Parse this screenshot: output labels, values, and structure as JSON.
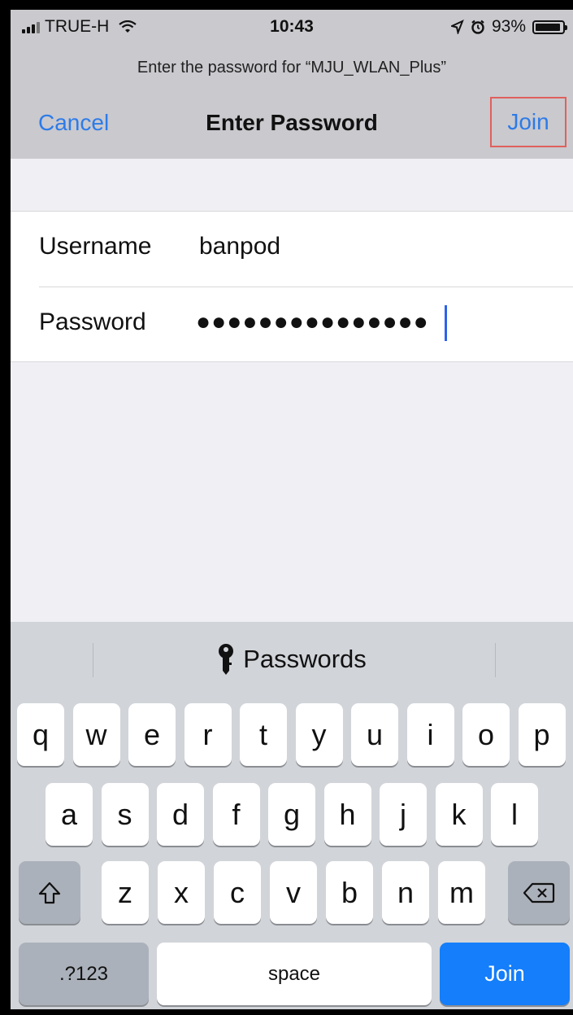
{
  "status_bar": {
    "carrier": "TRUE-H",
    "time": "10:43",
    "battery": "93%",
    "battery_level": 0.93
  },
  "prompt": "Enter the password for “MJU_WLAN_Plus”",
  "nav": {
    "cancel": "Cancel",
    "title": "Enter Password",
    "join": "Join"
  },
  "form": {
    "username_label": "Username",
    "username_value": "banpod",
    "password_label": "Password",
    "password_mask": "●●●●●●●●●●●●●●●"
  },
  "keyboard": {
    "suggestion": "Passwords",
    "row1": [
      "q",
      "w",
      "e",
      "r",
      "t",
      "y",
      "u",
      "i",
      "o",
      "p"
    ],
    "row2": [
      "a",
      "s",
      "d",
      "f",
      "g",
      "h",
      "j",
      "k",
      "l"
    ],
    "row3": [
      "z",
      "x",
      "c",
      "v",
      "b",
      "n",
      "m"
    ],
    "numbers_key": ".?123",
    "space_key": "space",
    "join_key": "Join"
  },
  "colors": {
    "accent": "#2d7be8",
    "join_key": "#147efb",
    "highlight_box": "#e0605c"
  }
}
